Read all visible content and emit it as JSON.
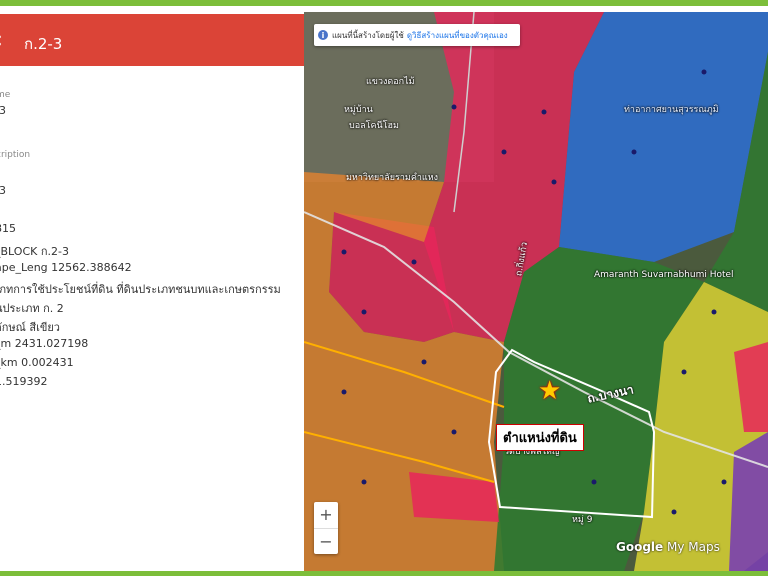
{
  "panel": {
    "title": "ก.2-3",
    "fields": [
      {
        "label": "me",
        "value": "-3"
      },
      {
        "label": "cription",
        "value": "-3"
      },
      {
        "label": "",
        "value": "815"
      },
      {
        "label": "",
        "value": "_BLOCK ก.2-3"
      },
      {
        "label": "",
        "value": "ape_Leng 12562.388642"
      },
      {
        "label": "",
        "value": "เภทการใช้ประโยชน์ที่ดิน ที่ดินประเภทชนบทและเกษตรกรรม"
      },
      {
        "label": "",
        "value": "นประเภท ก. 2"
      },
      {
        "label": "",
        "value": "ลักษณ์ สีเขียว"
      },
      {
        "label": "",
        "value": "_m 2431.027198"
      },
      {
        "label": "",
        "value": "_km 0.002431"
      },
      {
        "label": "",
        "value": "1.519392"
      }
    ]
  },
  "map": {
    "notice_text": "แผนที่นี้สร้างโดยผู้ใช้",
    "notice_link": "ดูวิธีสร้างแผนที่ของตัวคุณเอง",
    "zoom_in": "+",
    "zoom_out": "−",
    "land_label": "ตำแหน่งที่ดิน",
    "road_label": "ถ.บางนา",
    "places": {
      "p1": "แขวงดอกไม้",
      "p2": "หมู่บ้าน",
      "p3": "บอลโคนีโฮม",
      "p4": "มหาวิทยาลัยรามคำแหง",
      "p5": "ท่าอากาศยานสุวรรณภูมิ",
      "p6": "Amaranth Suvarnabhumi Hotel",
      "p7": "ถ.กิ่งแก้ว",
      "p8": "หมู่ 9",
      "p9": "วัดบางพลีใหญ่"
    },
    "logo_google": "Google",
    "logo_mymaps": " My Maps"
  },
  "colors": {
    "header": "#db4437",
    "frame": "#7cbe3a",
    "zone_red": "#e8265a",
    "zone_orange": "#e3822f",
    "zone_blue": "#2b6fd6",
    "zone_green": "#2f7a30",
    "zone_yellow": "#d8d233",
    "zone_purple": "#7a3fb0"
  }
}
